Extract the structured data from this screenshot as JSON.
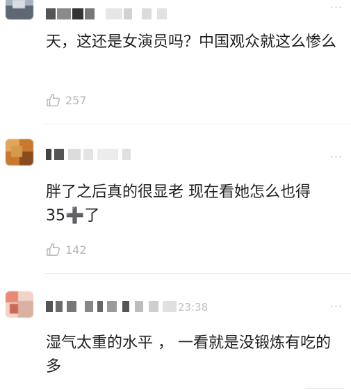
{
  "comments": [
    {
      "text": "天，这还是女演员吗？中国观众就这么惨么",
      "likes": "257",
      "time": ""
    },
    {
      "text_before": "胖了之后真的很显老  现在看她怎么也得35",
      "text_plus": "➕",
      "text_after": "了",
      "likes": "142",
      "time": ""
    },
    {
      "text": "湿气太重的水平 ， 一看就是没锻炼有吃的多",
      "likes": "",
      "time": "23:38"
    }
  ],
  "more_label": "···",
  "icons": {
    "like": "thumbs-up-outline-icon",
    "more": "more-dots-icon"
  }
}
